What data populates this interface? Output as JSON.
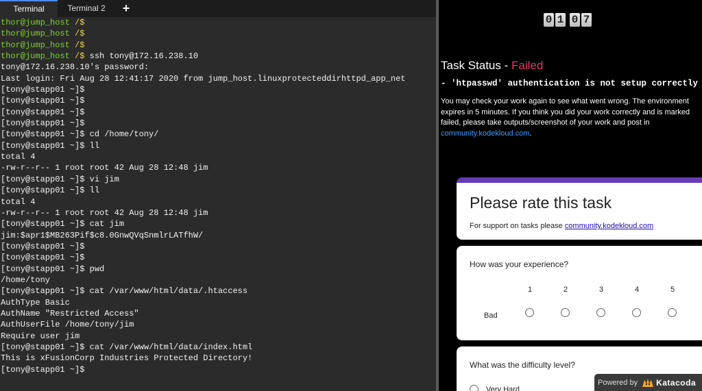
{
  "tabs": [
    {
      "label": "Terminal"
    },
    {
      "label": "Terminal 2"
    }
  ],
  "new_tab_label": "+",
  "terminal_lines": [
    {
      "prompt": "thor@jump_host",
      "path": " /$",
      "cmd": ""
    },
    {
      "prompt": "thor@jump_host",
      "path": " /$",
      "cmd": ""
    },
    {
      "prompt": "thor@jump_host",
      "path": " /$",
      "cmd": ""
    },
    {
      "prompt": "thor@jump_host",
      "path": " /$",
      "cmd": " ssh tony@172.16.238.10"
    },
    {
      "text": "tony@172.16.238.10's password:"
    },
    {
      "text": "Last login: Fri Aug 28 12:41:17 2020 from jump_host.linuxprotecteddirhttpd_app_net"
    },
    {
      "text": "[tony@stapp01 ~]$"
    },
    {
      "text": "[tony@stapp01 ~]$"
    },
    {
      "text": "[tony@stapp01 ~]$"
    },
    {
      "text": "[tony@stapp01 ~]$"
    },
    {
      "text": "[tony@stapp01 ~]$ cd /home/tony/"
    },
    {
      "text": "[tony@stapp01 ~]$ ll"
    },
    {
      "text": "total 4"
    },
    {
      "text": "-rw-r--r-- 1 root root 42 Aug 28 12:48 jim"
    },
    {
      "text": "[tony@stapp01 ~]$ vi jim"
    },
    {
      "text": "[tony@stapp01 ~]$ ll"
    },
    {
      "text": "total 4"
    },
    {
      "text": "-rw-r--r-- 1 root root 42 Aug 28 12:48 jim"
    },
    {
      "text": "[tony@stapp01 ~]$ cat jim"
    },
    {
      "text": "jim:$apr1$MB263Pif$c8.0GnwQVqSnmlrLATfhW/"
    },
    {
      "text": "[tony@stapp01 ~]$"
    },
    {
      "text": "[tony@stapp01 ~]$"
    },
    {
      "text": "[tony@stapp01 ~]$ pwd"
    },
    {
      "text": "/home/tony"
    },
    {
      "text": "[tony@stapp01 ~]$ cat /var/www/html/data/.htaccess"
    },
    {
      "text": "AuthType Basic"
    },
    {
      "text": "AuthName \"Restricted Access\""
    },
    {
      "text": "AuthUserFile /home/tony/jim"
    },
    {
      "text": "Require user jim"
    },
    {
      "text": "[tony@stapp01 ~]$ cat /var/www/html/data/index.html"
    },
    {
      "text": "This is xFusionCorp Industries Protected Directory!"
    },
    {
      "text": "[tony@stapp01 ~]$"
    }
  ],
  "timer": {
    "d1": "0",
    "d2": "1",
    "d3": "0",
    "d4": "7"
  },
  "status": {
    "title_prefix": "Task Status - ",
    "result": "Failed",
    "message": "- 'htpasswd' authentication is not setup correctly on App Ser",
    "help_text": "You may check your work again to see what went wrong. The environment expires in 5 minutes. If you think you did your work correctly and is marked failed, please take outputs/screenshot of your work and post in ",
    "help_link": "community.kodekloud.com",
    "help_suffix": "."
  },
  "rating": {
    "title": "Please rate this task",
    "support_prefix": "For support on tasks please ",
    "support_link": "community.kodekloud.com",
    "experience_question": "How was your experience?",
    "scale": [
      "1",
      "2",
      "3",
      "4",
      "5"
    ],
    "scale_low_label": "Bad",
    "difficulty_question": "What was the difficulty level?",
    "difficulty_option_1": "Very Hard"
  },
  "powered_by": {
    "prefix": "Powered by",
    "brand": "Katacoda"
  },
  "colors": {
    "failed": "#e8336a",
    "link": "#3f9cff",
    "form_accent": "#673ab7",
    "prompt_green": "#7cd42b",
    "prompt_yellow": "#e6d84a"
  }
}
